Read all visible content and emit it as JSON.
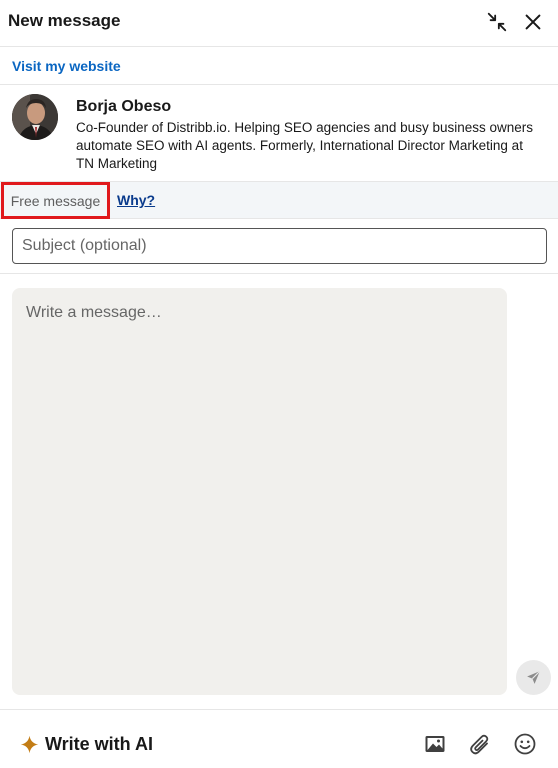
{
  "header": {
    "title": "New message",
    "minimize_icon": "minimize-arrows-icon",
    "close_icon": "close-icon"
  },
  "website": {
    "label": "Visit my website"
  },
  "profile": {
    "name": "Borja Obeso",
    "headline": "Co-Founder of Distribb.io. Helping SEO agencies and busy business owners automate SEO with AI agents. Formerly, International Director Marketing at TN Marketing"
  },
  "free_message": {
    "label": "Free message",
    "why_label": "Why?",
    "highlight_color": "#e0191c"
  },
  "subject": {
    "placeholder": "Subject (optional)",
    "value": ""
  },
  "message": {
    "placeholder": "Write a message…",
    "value": ""
  },
  "footer": {
    "ai_label": "Write with AI",
    "ai_icon": "sparkle-icon",
    "ai_icon_color": "#c37d16",
    "tools": [
      "image-icon",
      "paperclip-icon",
      "emoji-icon"
    ],
    "send_icon": "send-icon"
  },
  "colors": {
    "link": "#0a66c2",
    "why_link": "#0a3b8c",
    "message_bg": "#f1f0ed",
    "free_row_bg": "#f3f6f8"
  }
}
